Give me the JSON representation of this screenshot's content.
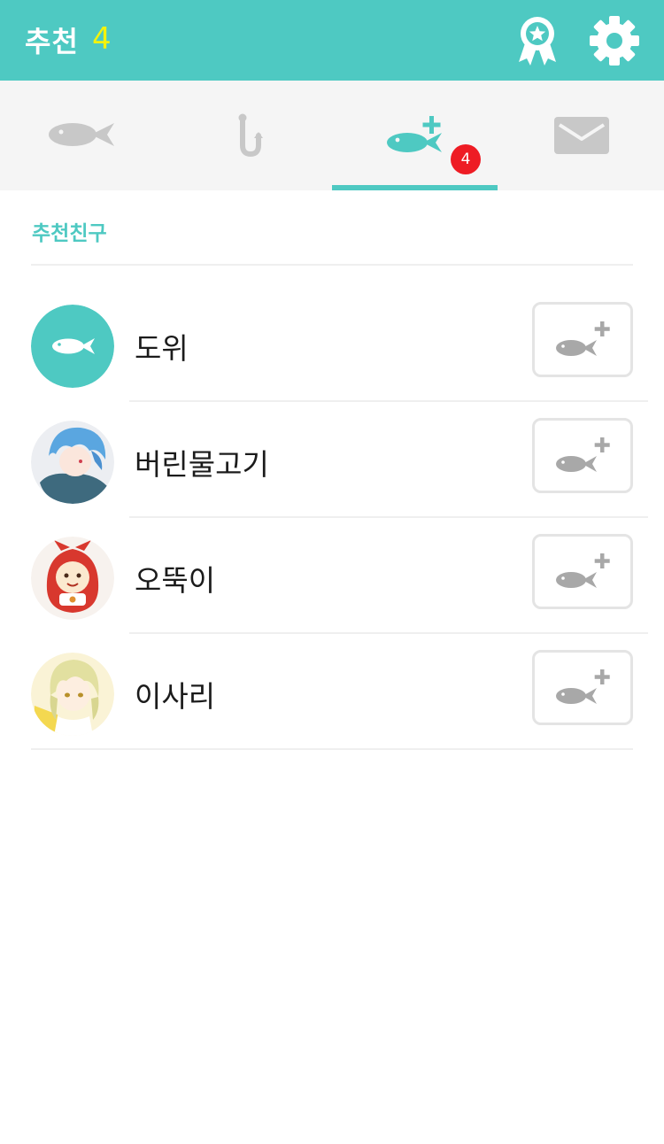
{
  "header": {
    "title": "추천",
    "count": "4",
    "icons": [
      "award-ribbon-icon",
      "gear-icon"
    ],
    "colors": {
      "bar": "#4ec9c2",
      "count": "#f4f30c"
    }
  },
  "tabs": [
    {
      "icon": "fish-icon",
      "active": false
    },
    {
      "icon": "fishhook-icon",
      "active": false
    },
    {
      "icon": "fish-add-icon",
      "active": true,
      "badge": "4"
    },
    {
      "icon": "mail-icon",
      "active": false
    }
  ],
  "section": {
    "title": "추천친구"
  },
  "friends": [
    {
      "name": "도위",
      "avatar": "default-fish-avatar",
      "action_icon": "fish-add-icon"
    },
    {
      "name": "버린물고기",
      "avatar": "blue-hair-character-avatar",
      "action_icon": "fish-add-icon"
    },
    {
      "name": "오뚝이",
      "avatar": "red-hood-character-avatar",
      "action_icon": "fish-add-icon"
    },
    {
      "name": "이사리",
      "avatar": "blonde-character-avatar",
      "action_icon": "fish-add-icon"
    }
  ],
  "colors": {
    "accent": "#4ec9c2",
    "badge": "#ee1c24",
    "inactive_icon": "#c8c8c8"
  }
}
